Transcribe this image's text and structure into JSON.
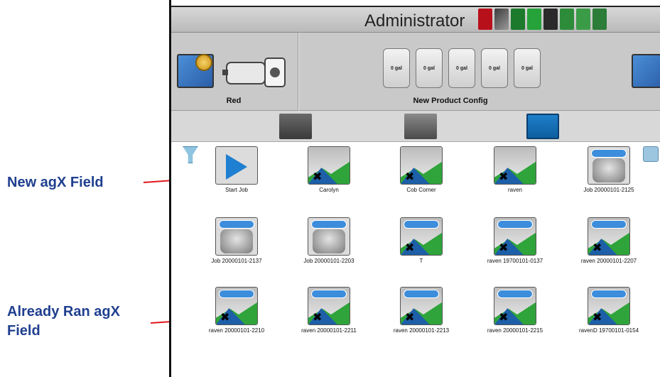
{
  "callouts": {
    "new_field": "New agX Field",
    "already_ran_line1": "Already Ran agX",
    "already_ran_line2": "Field"
  },
  "titlebar": {
    "title": "Administrator"
  },
  "config": {
    "machine_label": "Red",
    "product_label": "New Product Config",
    "tanks": [
      "0 gal",
      "0 gal",
      "0 gal",
      "0 gal",
      "0 gal"
    ]
  },
  "jobs": [
    {
      "label": "Start Job",
      "kind": "start"
    },
    {
      "label": "Carolyn",
      "kind": "new-field"
    },
    {
      "label": "Cob Corner",
      "kind": "new-field"
    },
    {
      "label": "raven",
      "kind": "new-field"
    },
    {
      "label": "Job 20000101-2125",
      "kind": "job"
    },
    {
      "label": "Job 20000101-2137",
      "kind": "job"
    },
    {
      "label": "Job 20000101-2203",
      "kind": "job"
    },
    {
      "label": "T",
      "kind": "ran-field"
    },
    {
      "label": "raven 19700101-0137",
      "kind": "ran-field"
    },
    {
      "label": "raven 20000101-2207",
      "kind": "ran-field"
    },
    {
      "label": "raven 20000101-2210",
      "kind": "ran-field"
    },
    {
      "label": "raven 20000101-2211",
      "kind": "ran-field"
    },
    {
      "label": "raven 20000101-2213",
      "kind": "ran-field"
    },
    {
      "label": "raven 20000101-2215",
      "kind": "ran-field"
    },
    {
      "label": "ravenD 19700101-0154",
      "kind": "ran-field"
    }
  ],
  "colors": {
    "callout_text": "#1f3f8f",
    "callout_line": "#e0161b",
    "field_green": "#2fa43a",
    "field_blue": "#1d5fa8"
  }
}
